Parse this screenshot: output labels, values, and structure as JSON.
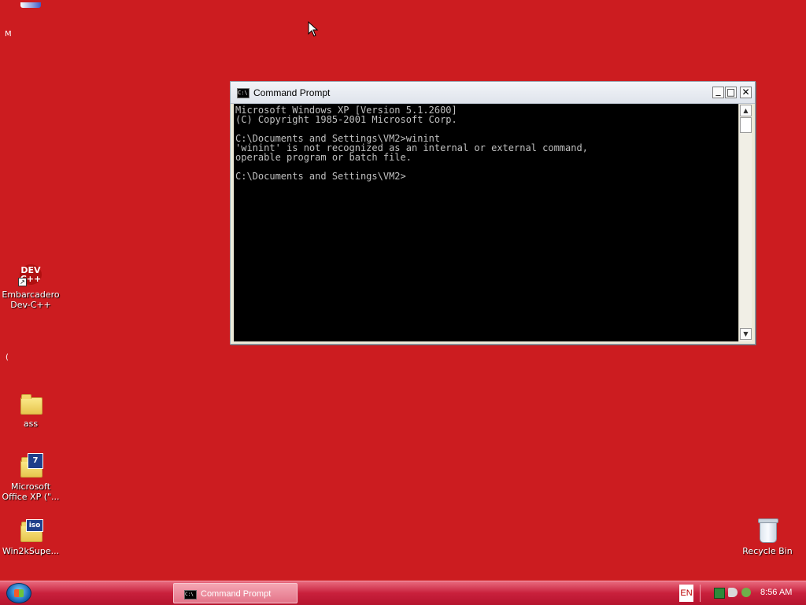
{
  "colors": {
    "desktop": "#cc1c20",
    "taskbar": "#c9203c",
    "console_bg": "#000000",
    "console_fg": "#c0c0c0"
  },
  "desktop": {
    "partial_top_label": "M",
    "partial_mid_label": "(",
    "icons": [
      {
        "label": "Embarcadero Dev-C++",
        "icon": "dev-cpp-icon",
        "glyph_text": "DEV\nC++"
      },
      {
        "label": "ass",
        "icon": "folder-icon"
      },
      {
        "label": "Microsoft Office XP (\"...",
        "icon": "office-folder-icon",
        "badge": "7"
      },
      {
        "label": "Win2kSupe...",
        "icon": "iso-folder-icon",
        "badge": "iso"
      },
      {
        "label": "Recycle Bin",
        "icon": "recycle-bin-icon"
      }
    ]
  },
  "cmd_window": {
    "title": "Command Prompt",
    "icon_text": "C:\\",
    "buttons": {
      "minimize": "_",
      "maximize": "□",
      "close": "✕"
    },
    "console_text": "Microsoft Windows XP [Version 5.1.2600]\n(C) Copyright 1985-2001 Microsoft Corp.\n\nC:\\Documents and Settings\\VM2>winint\n'winint' is not recognized as an internal or external command,\noperable program or batch file.\n\nC:\\Documents and Settings\\VM2>",
    "scroll_up": "▲",
    "scroll_down": "▼"
  },
  "taskbar": {
    "task_label": "Command Prompt",
    "task_icon_text": "C:\\",
    "language": "EN",
    "clock": "8:56 AM"
  }
}
